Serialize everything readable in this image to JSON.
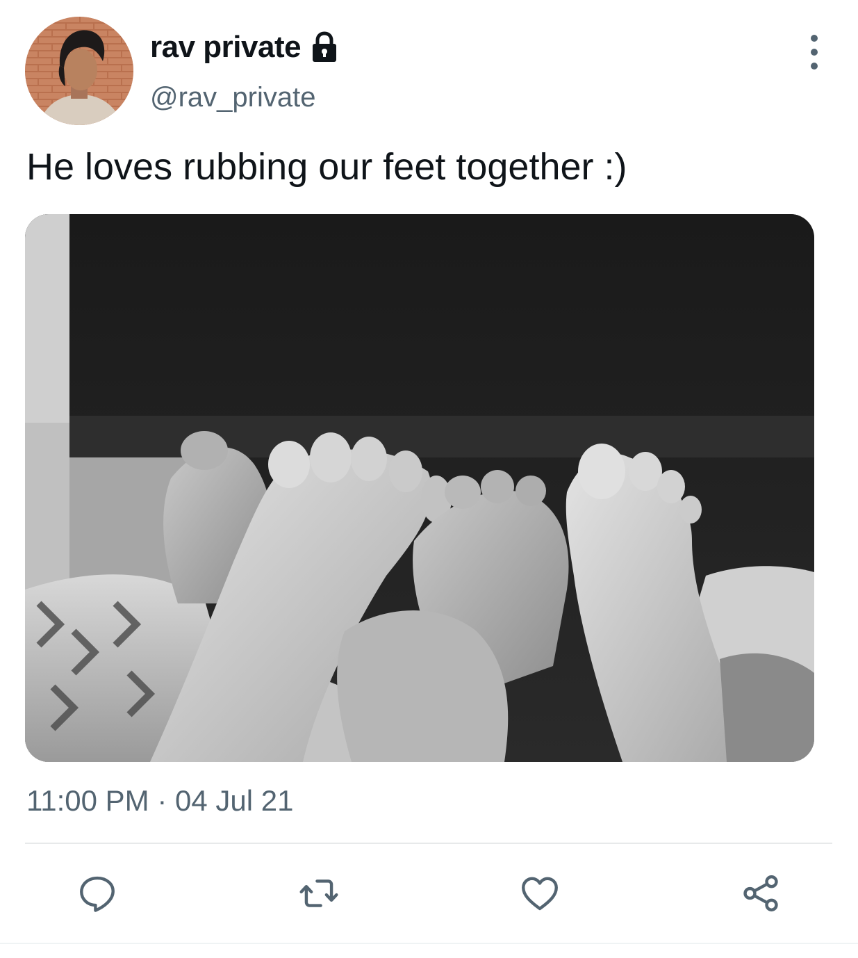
{
  "user": {
    "display_name": "rav private",
    "handle": "@rav_private",
    "protected_icon": "lock-icon",
    "avatar_alt": "profile photo"
  },
  "tweet": {
    "text": "He loves rubbing our feet together :)",
    "timestamp": "11:00 PM · 04 Jul 21",
    "media_type": "photo"
  },
  "actions": [
    {
      "name": "reply",
      "icon": "reply-icon"
    },
    {
      "name": "retweet",
      "icon": "retweet-icon"
    },
    {
      "name": "like",
      "icon": "heart-icon"
    },
    {
      "name": "share",
      "icon": "share-icon"
    }
  ],
  "menu": {
    "icon": "more-vertical-icon"
  },
  "colors": {
    "text_primary": "#0f1419",
    "text_secondary": "#536471",
    "divider": "#e7e9ea"
  }
}
